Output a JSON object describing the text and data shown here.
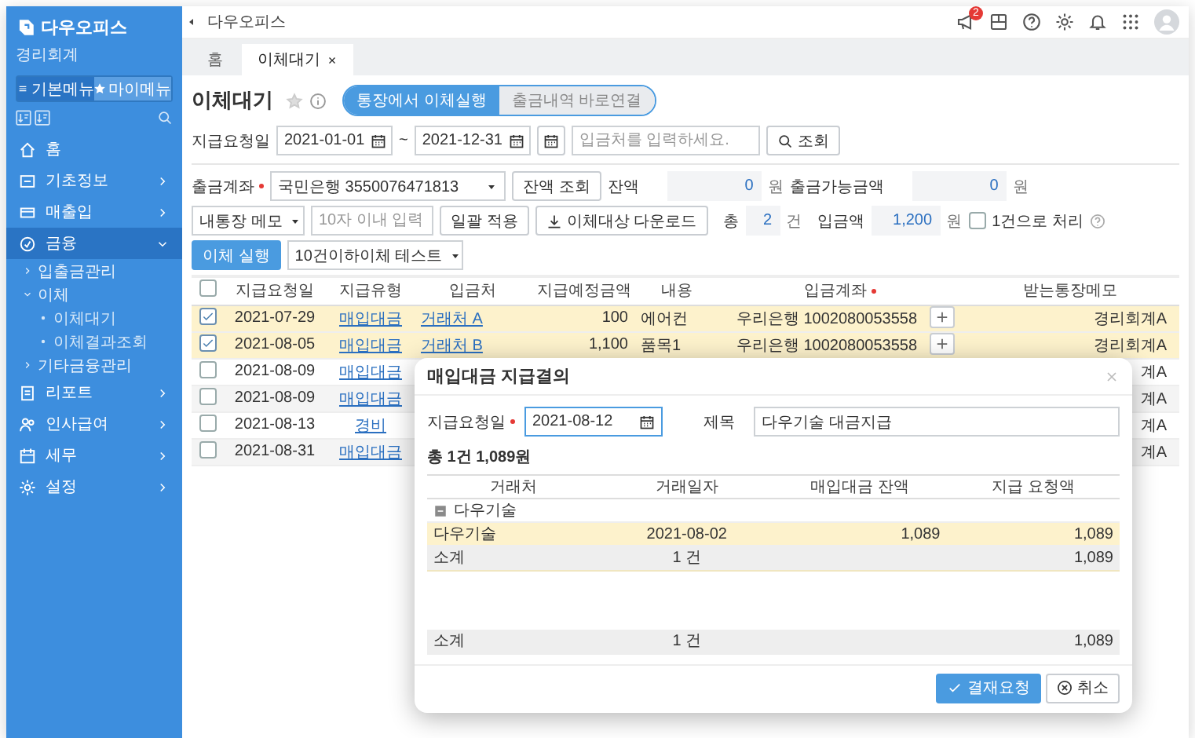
{
  "sidebar": {
    "brand": "다우오피스",
    "subtitle": "경리회계",
    "menu_tabs": [
      {
        "label": "기본메뉴",
        "selected": true
      },
      {
        "label": "마이메뉴",
        "selected": false
      }
    ],
    "items": [
      {
        "label": "홈",
        "kind": "link",
        "selected": false
      },
      {
        "label": "기초정보",
        "kind": "group",
        "selected": false,
        "expanded": false
      },
      {
        "label": "매출입",
        "kind": "group",
        "selected": false,
        "expanded": false
      },
      {
        "label": "금융",
        "kind": "group",
        "selected": true,
        "expanded": true,
        "children": [
          {
            "label": "입출금관리",
            "selected": false,
            "expanded": false
          },
          {
            "label": "이체",
            "selected": false,
            "expanded": true,
            "children": [
              {
                "label": "이체대기",
                "selected": false
              },
              {
                "label": "이체결과조회",
                "selected": false
              }
            ]
          },
          {
            "label": "기타금융관리",
            "selected": false,
            "expanded": false
          }
        ]
      },
      {
        "label": "리포트",
        "kind": "group",
        "selected": false,
        "expanded": false
      },
      {
        "label": "인사급여",
        "kind": "group",
        "selected": false,
        "expanded": false
      },
      {
        "label": "세무",
        "kind": "group",
        "selected": false,
        "expanded": false
      },
      {
        "label": "설정",
        "kind": "group",
        "selected": false,
        "expanded": false
      }
    ]
  },
  "topbar": {
    "title": "다우오피스",
    "notification_count": "2"
  },
  "tabs": [
    {
      "label": "홈",
      "selected": false,
      "closable": false
    },
    {
      "label": "이체대기",
      "selected": true,
      "closable": true
    }
  ],
  "page": {
    "title": "이체대기",
    "favorite": false,
    "modes": [
      {
        "label": "통장에서 이체실행",
        "selected": true
      },
      {
        "label": "출금내역 바로연결",
        "selected": false
      }
    ]
  },
  "filter": {
    "date_label": "지급요청일",
    "date_from": "2021-01-01",
    "date_separator": "~",
    "date_to": "2021-12-31",
    "payee_placeholder": "입금처를 입력하세요.",
    "search_button": "조회"
  },
  "account_row": {
    "account_label": "출금계좌",
    "account_required": true,
    "account": "국민은행 3550076471813",
    "balance_button": "잔액 조회",
    "balance_label": "잔액",
    "balance": "0",
    "balance_unit": "원",
    "available_label": "출금가능금액",
    "available": "0",
    "available_unit": "원"
  },
  "action_row": {
    "memo_select": "내통장 메모",
    "memo_placeholder": "10자 이내 입력",
    "apply_button": "일괄 적용",
    "download_button": "이체대상 다운로드",
    "total_label": "총",
    "total_count": "2",
    "count_unit": "건",
    "amount_label": "입금액",
    "amount": "1,200",
    "amount_unit": "원",
    "single_label": "1건으로 처리",
    "single_checked": false,
    "execute_button": "이체 실행",
    "test_select": "10건이하이체 테스트"
  },
  "table": {
    "all_checked": false,
    "columns": [
      {
        "label": "지급요청일",
        "required": false
      },
      {
        "label": "지급유형",
        "required": false
      },
      {
        "label": "입금처",
        "required": false
      },
      {
        "label": "지급예정금액",
        "required": false
      },
      {
        "label": "내용",
        "required": false
      },
      {
        "label": "입금계좌",
        "required": true
      },
      {
        "label": "받는통장메모",
        "required": false
      }
    ],
    "rows": [
      {
        "checked": true,
        "selected": true,
        "date": "2021-07-29",
        "type": "매입대금",
        "payee": "거래처 A",
        "amount": "100",
        "content": "에어컨",
        "account": "우리은행 1002080053558",
        "memo": "경리회계A"
      },
      {
        "checked": true,
        "selected": true,
        "date": "2021-08-05",
        "type": "매입대금",
        "payee": "거래처 B",
        "amount": "1,100",
        "content": "품목1",
        "account": "우리은행 1002080053558",
        "memo": "경리회계A"
      },
      {
        "checked": false,
        "selected": false,
        "date": "2021-08-09",
        "type": "매입대금",
        "memo": "계A"
      },
      {
        "checked": false,
        "selected": false,
        "date": "2021-08-09",
        "type": "매입대금",
        "memo": "계A"
      },
      {
        "checked": false,
        "selected": false,
        "date": "2021-08-13",
        "type": "경비",
        "memo": "계A"
      },
      {
        "checked": false,
        "selected": false,
        "date": "2021-08-31",
        "type": "매입대금",
        "memo": "계A"
      }
    ]
  },
  "modal": {
    "title": "매입대금 지급결의",
    "date_label": "지급요청일",
    "date_required": true,
    "date": "2021-08-12",
    "date_focused": true,
    "subject_label": "제목",
    "subject": "다우기술 대금지급",
    "summary": "총 1건 1,089원",
    "columns": [
      "거래처",
      "거래일자",
      "매입대금 잔액",
      "지급 요청액"
    ],
    "groups": [
      {
        "name": "다우기술",
        "expanded": true,
        "rows": [
          {
            "selected": true,
            "cells": [
              "다우기술",
              "2021-08-02",
              "1,089",
              "1,089"
            ]
          }
        ],
        "subtotal": {
          "label": "소계",
          "count": "1 건",
          "amount": "1,089"
        }
      }
    ],
    "total": {
      "label": "소계",
      "count": "1 건",
      "amount": "1,089"
    },
    "buttons": [
      {
        "label": "결재요청",
        "kind": "primary"
      },
      {
        "label": "취소",
        "kind": "cancel"
      }
    ]
  }
}
